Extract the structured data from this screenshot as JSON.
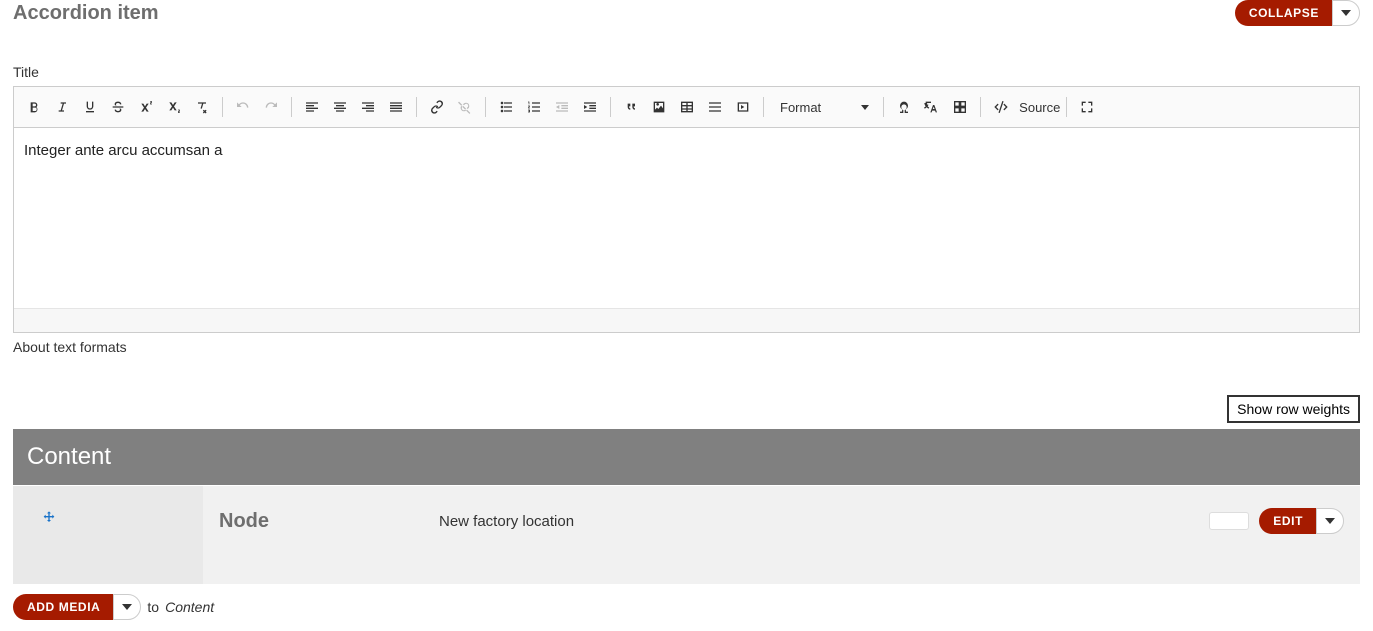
{
  "header": {
    "title": "Accordion item",
    "collapse_label": "COLLAPSE"
  },
  "title_label": "Title",
  "toolbar": {
    "format_label": "Format",
    "source_label": "Source"
  },
  "editor_content": "Integer ante arcu accumsan a",
  "about_link": "About text formats",
  "show_row_weights_label": "Show row weights",
  "content_header": "Content",
  "node_row": {
    "label": "Node",
    "title": "New factory location",
    "edit_label": "EDIT"
  },
  "add_media": {
    "label": "ADD MEDIA",
    "to_text": "to",
    "target": "Content"
  }
}
